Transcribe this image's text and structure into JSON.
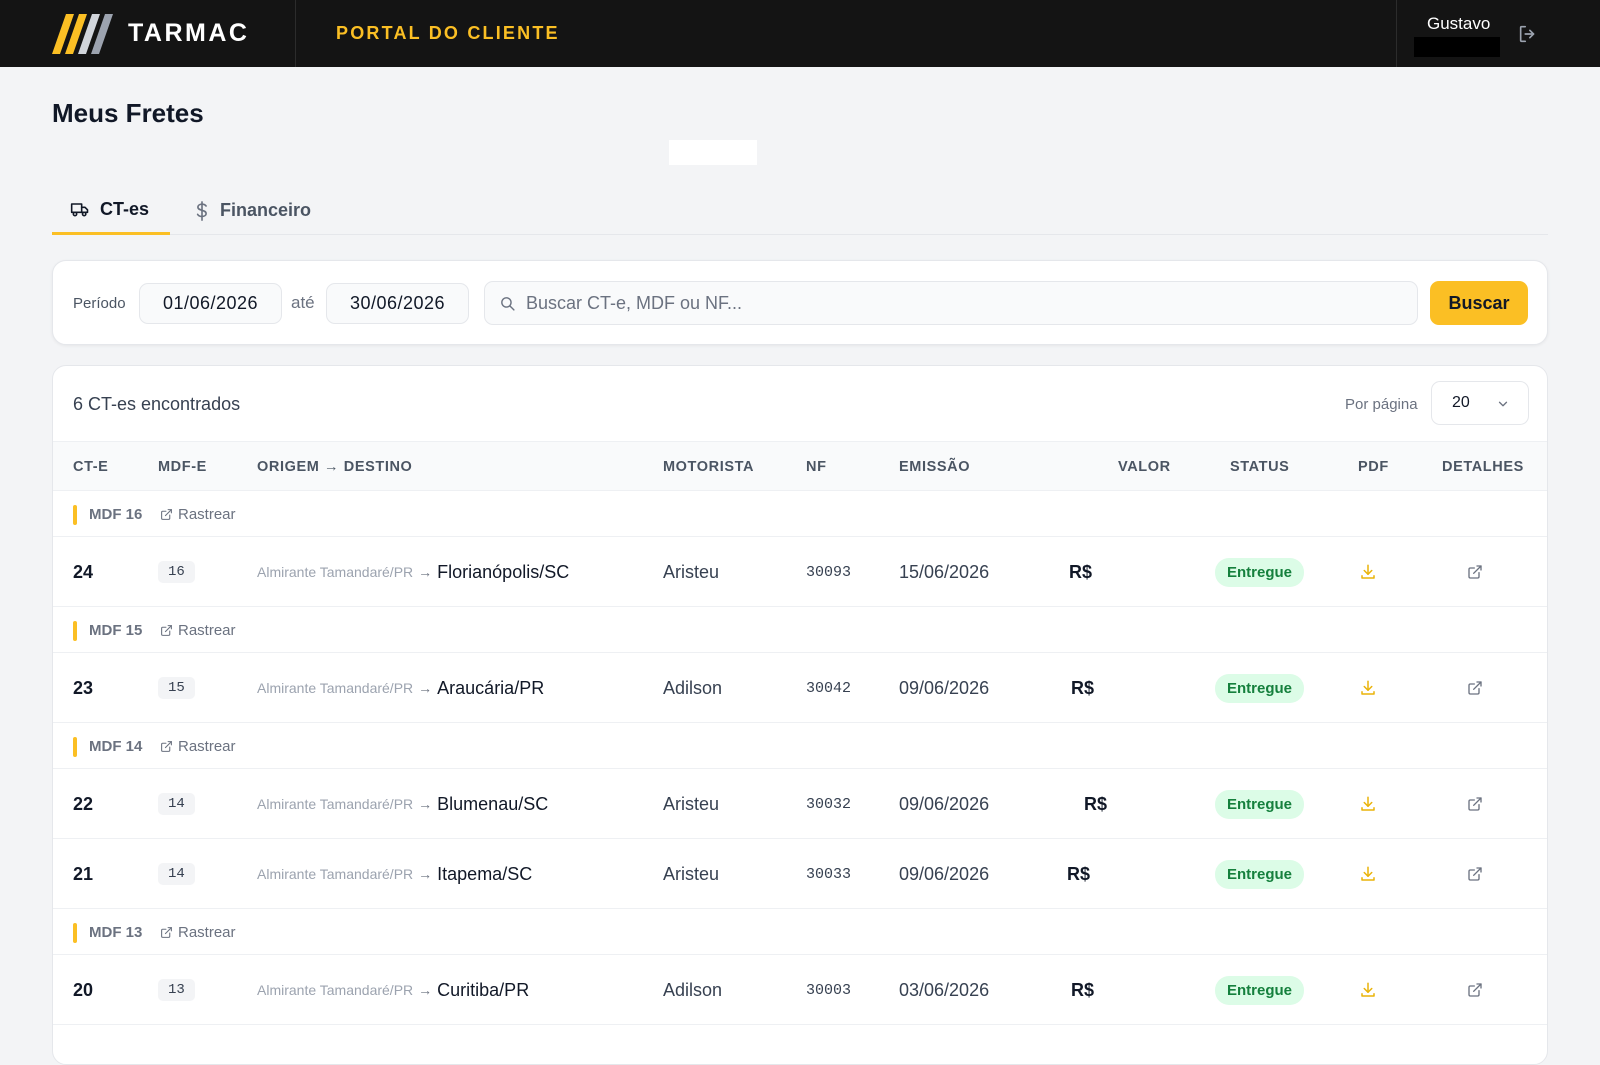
{
  "header": {
    "logo_text": "TARMAC",
    "portal_title": "PORTAL DO CLIENTE",
    "user_name": "Gustavo"
  },
  "page": {
    "title": "Meus Fretes"
  },
  "tabs": [
    {
      "label": "CT-es",
      "icon": "truck-icon",
      "active": true
    },
    {
      "label": "Financeiro",
      "icon": "dollar-icon",
      "active": false
    }
  ],
  "filter": {
    "period_label": "Período",
    "date_from": "01/06/2026",
    "separator": "até",
    "date_to": "30/06/2026",
    "search_placeholder": "Buscar CT-e, MDF ou NF...",
    "search_button": "Buscar"
  },
  "results": {
    "count_text": "6 CT-es encontrados",
    "per_page_label": "Por página",
    "per_page_value": "20"
  },
  "columns": [
    "CT-E",
    "MDF-E",
    "ORIGEM → DESTINO",
    "MOTORISTA",
    "NF",
    "EMISSÃO",
    "VALOR",
    "STATUS",
    "PDF",
    "DETALHES"
  ],
  "track_label": "Rastrear",
  "groups": [
    {
      "label": "MDF 16",
      "rows": [
        {
          "cte": "24",
          "mdf": "16",
          "origin": "Almirante Tamandaré/PR",
          "dest": "Florianópolis/SC",
          "driver": "Aristeu",
          "nf": "30093",
          "date": "15/06/2026",
          "value": "R$",
          "status": "Entregue"
        }
      ]
    },
    {
      "label": "MDF 15",
      "rows": [
        {
          "cte": "23",
          "mdf": "15",
          "origin": "Almirante Tamandaré/PR",
          "dest": "Araucária/PR",
          "driver": "Adilson",
          "nf": "30042",
          "date": "09/06/2026",
          "value": "R$",
          "status": "Entregue"
        }
      ]
    },
    {
      "label": "MDF 14",
      "rows": [
        {
          "cte": "22",
          "mdf": "14",
          "origin": "Almirante Tamandaré/PR",
          "dest": "Blumenau/SC",
          "driver": "Aristeu",
          "nf": "30032",
          "date": "09/06/2026",
          "value": "R$",
          "status": "Entregue"
        },
        {
          "cte": "21",
          "mdf": "14",
          "origin": "Almirante Tamandaré/PR",
          "dest": "Itapema/SC",
          "driver": "Aristeu",
          "nf": "30033",
          "date": "09/06/2026",
          "value": "R$",
          "status": "Entregue"
        }
      ]
    },
    {
      "label": "MDF 13",
      "rows": [
        {
          "cte": "20",
          "mdf": "13",
          "origin": "Almirante Tamandaré/PR",
          "dest": "Curitiba/PR",
          "driver": "Adilson",
          "nf": "30003",
          "date": "03/06/2026",
          "value": "R$",
          "status": "Entregue"
        }
      ]
    }
  ],
  "colors": {
    "accent": "#fbbf24",
    "topbar": "#141414",
    "status_bg": "#dcfce7",
    "status_text": "#15803d"
  }
}
